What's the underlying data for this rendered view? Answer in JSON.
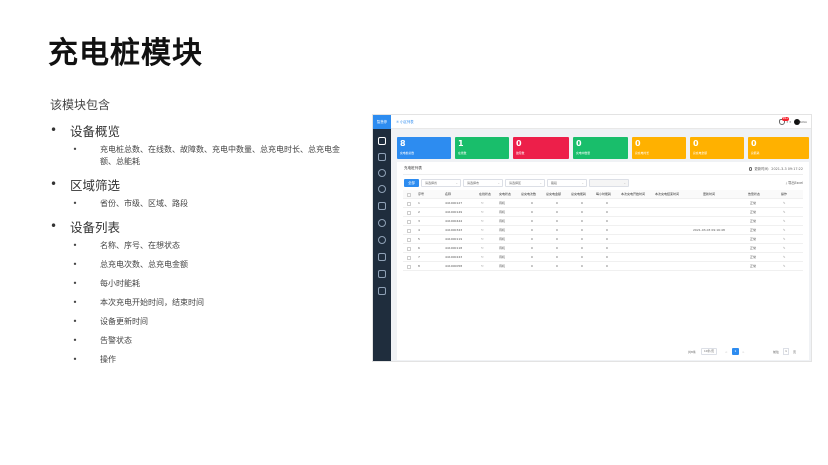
{
  "slide": {
    "title": "充电桩模块",
    "intro": "该模块包含",
    "sections": [
      {
        "heading": "设备概览",
        "items": [
          "充电桩总数、在线数、故障数、充电中数量、总充电时长、总充电金额、总能耗"
        ]
      },
      {
        "heading": "区域筛选",
        "items": [
          "省份、市级、区域、路段"
        ]
      },
      {
        "heading": "设备列表",
        "items": [
          "名称、序号、在想状态",
          "总充电次数、总充电金额",
          "每小时能耗",
          "本次充电开始时间，结束时间",
          "设备更新时间",
          "告警状态",
          "操作"
        ]
      }
    ]
  },
  "app": {
    "logo": "智慧停",
    "breadcrumb": "⑦ 小区列表",
    "badge": "99+",
    "user_extra": "3 3",
    "user_name": "admin",
    "cards": [
      {
        "num": "8",
        "label": "充电桩总数",
        "color": "#2d8cf0"
      },
      {
        "num": "1",
        "label": "在线数",
        "color": "#19be6b"
      },
      {
        "num": "0",
        "label": "故障数",
        "color": "#ed1f4a"
      },
      {
        "num": "0",
        "label": "充电中数量",
        "color": "#19be6b"
      },
      {
        "num": "0",
        "label": "总充电时长",
        "color": "#ffb100"
      },
      {
        "num": "0",
        "label": "总充电金额",
        "color": "#ffb100"
      },
      {
        "num": "0",
        "label": "总能耗",
        "color": "#ffb100"
      }
    ],
    "panel_title": "充电桩列表",
    "refresh": "更新时间：2021-3-3 09:17:22",
    "filter_tag": "全部",
    "filters": [
      "请选择省",
      "请选择市",
      "请选择区",
      "路段",
      ""
    ],
    "export_label": "导出Excel",
    "columns": [
      "序号",
      "名称",
      "在线状态",
      "充电状态",
      "总充电次数",
      "总充电金额",
      "总充电能耗",
      "每小时能耗",
      "本次充电开始时间",
      "本次充电结束时间",
      "更新时间",
      "告警状态",
      "操作"
    ],
    "rows": [
      {
        "no": "1",
        "name": "441000127",
        "online": "",
        "status": "待机",
        "times": "0",
        "money": "0",
        "energy": "0",
        "hourly": "0",
        "start": "",
        "end": "",
        "update": "",
        "alarm": "正常",
        "op": ""
      },
      {
        "no": "2",
        "name": "441000149",
        "online": "",
        "status": "待机",
        "times": "0",
        "money": "0",
        "energy": "0",
        "hourly": "0",
        "start": "",
        "end": "",
        "update": "",
        "alarm": "正常",
        "op": ""
      },
      {
        "no": "3",
        "name": "441000444",
        "online": "",
        "status": "待机",
        "times": "0",
        "money": "0",
        "energy": "0",
        "hourly": "0",
        "start": "",
        "end": "",
        "update": "",
        "alarm": "正常",
        "op": ""
      },
      {
        "no": "4",
        "name": "441000343",
        "online": "",
        "status": "待机",
        "times": "0",
        "money": "0",
        "energy": "0",
        "hourly": "0",
        "start": "",
        "end": "",
        "update": "2021-03-03 09:16:48",
        "alarm": "正常",
        "op": ""
      },
      {
        "no": "5",
        "name": "441000119",
        "online": "",
        "status": "待机",
        "times": "0",
        "money": "0",
        "energy": "0",
        "hourly": "0",
        "start": "",
        "end": "",
        "update": "",
        "alarm": "正常",
        "op": ""
      },
      {
        "no": "6",
        "name": "441000118",
        "online": "",
        "status": "待机",
        "times": "0",
        "money": "0",
        "energy": "0",
        "hourly": "0",
        "start": "",
        "end": "",
        "update": "",
        "alarm": "正常",
        "op": ""
      },
      {
        "no": "7",
        "name": "441000243",
        "online": "",
        "status": "待机",
        "times": "0",
        "money": "0",
        "energy": "0",
        "hourly": "0",
        "start": "",
        "end": "",
        "update": "",
        "alarm": "正常",
        "op": ""
      },
      {
        "no": "8",
        "name": "441000058",
        "online": "",
        "status": "待机",
        "times": "0",
        "money": "0",
        "energy": "0",
        "hourly": "0",
        "start": "",
        "end": "",
        "update": "",
        "alarm": "正常",
        "op": ""
      }
    ],
    "pager": {
      "total": "共8条",
      "size": "10条/页",
      "prev": "<",
      "current": "1",
      "next": ">",
      "goto": "前往",
      "page": "1",
      "suffix": "页"
    },
    "nav_icons": [
      "document-icon",
      "parking-icon",
      "settings-icon",
      "settings-icon",
      "monitor-icon",
      "clock-icon",
      "pie-chart-icon",
      "camera-icon",
      "lightning-icon",
      "layers-icon"
    ]
  }
}
